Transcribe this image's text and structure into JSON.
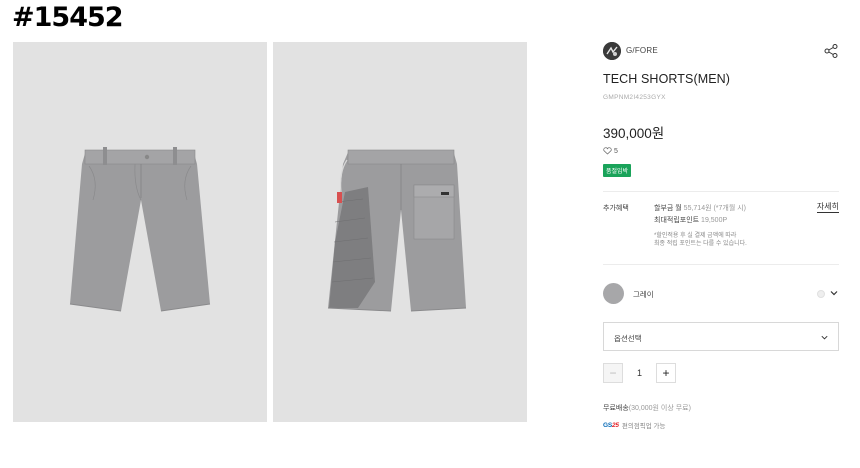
{
  "page_id": "#15452",
  "gallery": {
    "images": [
      {
        "name": "front-view"
      },
      {
        "name": "back-view"
      }
    ]
  },
  "brand": {
    "name": "G/FORE",
    "logo_icon": "brand-logo-icon"
  },
  "product": {
    "title": "TECH SHORTS(MEN)",
    "code": "GMPNM2I4253GYX",
    "price": "390,000원",
    "like_count": "5",
    "badge": "품절임박"
  },
  "benefits": {
    "label": "추가혜택",
    "installment_prefix": "할부금 월",
    "installment_detail": "55,714원 (*7개월 시)",
    "points_prefix": "최대적립포인트",
    "points_value": "19,500P",
    "note_line1": "*할인적용 후 실 결제 금액에 따라",
    "note_line2": "최종 적립 포인트는 다를 수 있습니다.",
    "detail_link": "자세히"
  },
  "color_option": {
    "name": "그레이",
    "swatch_color": "#a7a7a9"
  },
  "option_select": {
    "label": "옵션선택"
  },
  "quantity": {
    "value": "1",
    "minus_label": "−",
    "plus_label": "+"
  },
  "shipping": {
    "prefix": "무료배송",
    "detail": "(30,000원 이상 무료)"
  },
  "gs_delivery": {
    "logo_text": "GS",
    "logo_num": "25",
    "text": "편의점픽업 가능"
  },
  "colors": {
    "badge_green": "#1aa35a",
    "shorts_gray": "#9c9c9e",
    "gallery_bg": "#e2e2e2"
  }
}
